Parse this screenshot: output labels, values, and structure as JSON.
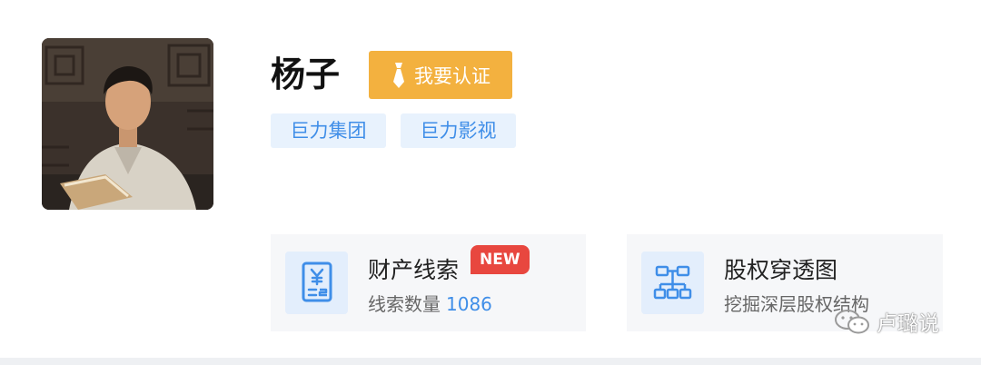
{
  "profile": {
    "name": "杨子",
    "verify_label": "我要认证",
    "tags": [
      "巨力集团",
      "巨力影视"
    ]
  },
  "cards": {
    "assets": {
      "title": "财产线索",
      "badge": "NEW",
      "subtitle_label": "线索数量",
      "count": "1086",
      "icon": "document-yuan-icon"
    },
    "equity": {
      "title": "股权穿透图",
      "subtitle": "挖掘深层股权结构",
      "icon": "org-chart-icon"
    }
  },
  "watermark": {
    "text": "卢璐说",
    "icon": "wechat-icon"
  },
  "colors": {
    "accent_blue": "#3f8ee8",
    "verify_orange": "#f3b13f",
    "badge_red": "#e8473f",
    "tag_bg": "#e8f2fd",
    "card_bg": "#f6f7f9"
  }
}
